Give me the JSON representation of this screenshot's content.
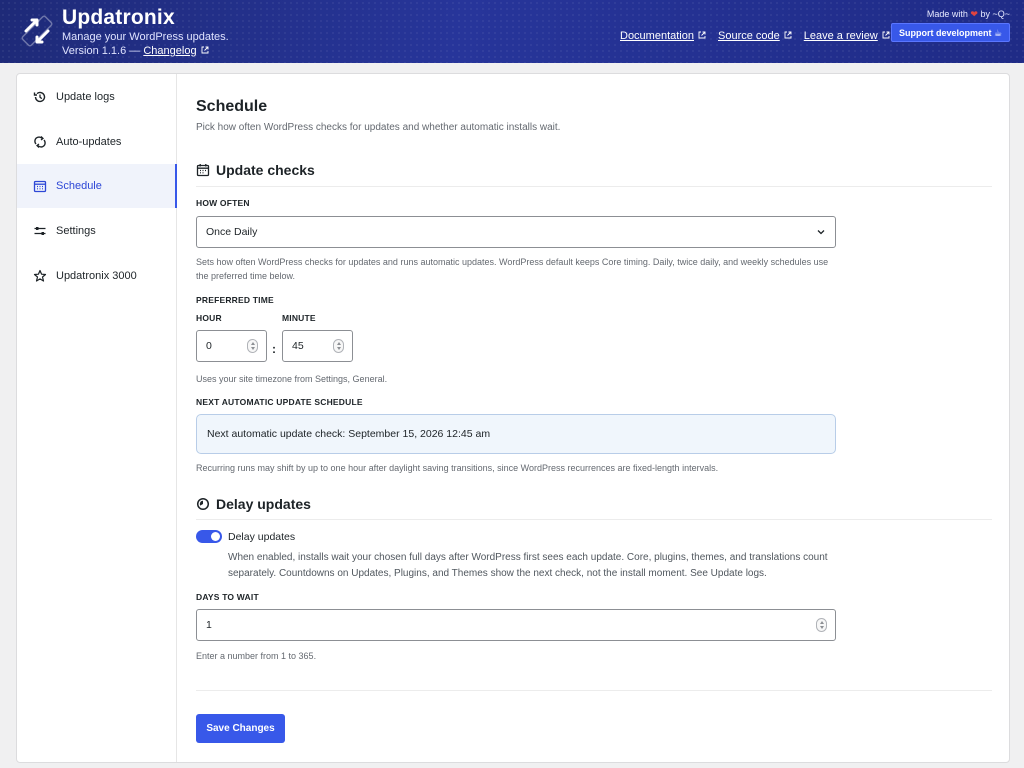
{
  "header": {
    "app_name": "Updatronix",
    "tagline": "Manage your WordPress updates.",
    "version_text": "Version 1.1.6 —",
    "changelog_label": "Changelog",
    "made_with_prefix": "Made with",
    "made_with_suffix": "by ~Q~",
    "links": [
      "Documentation",
      "Source code",
      "Leave a review"
    ],
    "support_label": "Support development ☕"
  },
  "sidebar": {
    "items": [
      {
        "label": "Update logs",
        "icon": "history-icon"
      },
      {
        "label": "Auto-updates",
        "icon": "sync-icon"
      },
      {
        "label": "Schedule",
        "icon": "calendar-icon",
        "active": true
      },
      {
        "label": "Settings",
        "icon": "sliders-icon"
      },
      {
        "label": "Updatronix 3000",
        "icon": "star-icon"
      }
    ]
  },
  "page": {
    "title": "Schedule",
    "subtitle": "Pick how often WordPress checks for updates and whether automatic installs wait."
  },
  "update_checks": {
    "heading": "Update checks",
    "how_often_label": "HOW OFTEN",
    "how_often_value": "Once Daily",
    "how_often_help": "Sets how often WordPress checks for updates and runs automatic updates. WordPress default keeps Core timing. Daily, twice daily, and weekly schedules use the preferred time below.",
    "preferred_time_label": "PREFERRED TIME",
    "hour_label": "HOUR",
    "hour_value": "0",
    "minute_label": "MINUTE",
    "minute_value": "45",
    "separator": ":",
    "timezone_help": "Uses your site timezone from Settings, General.",
    "next_schedule_label": "NEXT AUTOMATIC UPDATE SCHEDULE",
    "next_schedule_text": "Next automatic update check: September 15, 2026 12:45 am",
    "dst_help": "Recurring runs may shift by up to one hour after daylight saving transitions, since WordPress recurrences are fixed-length intervals."
  },
  "delay_updates": {
    "heading": "Delay updates",
    "toggle_label": "Delay updates",
    "toggle_on": true,
    "description": "When enabled, installs wait your chosen full days after WordPress first sees each update. Core, plugins, themes, and translations count separately. Countdowns on Updates, Plugins, and Themes show the next check, not the install moment. See Update logs.",
    "days_label": "DAYS TO WAIT",
    "days_value": "1",
    "days_help": "Enter a number from 1 to 365."
  },
  "actions": {
    "save_label": "Save Changes"
  },
  "colors": {
    "accent": "#3858e9",
    "header": "#27359a",
    "notice_bg": "#f0f6fc"
  }
}
